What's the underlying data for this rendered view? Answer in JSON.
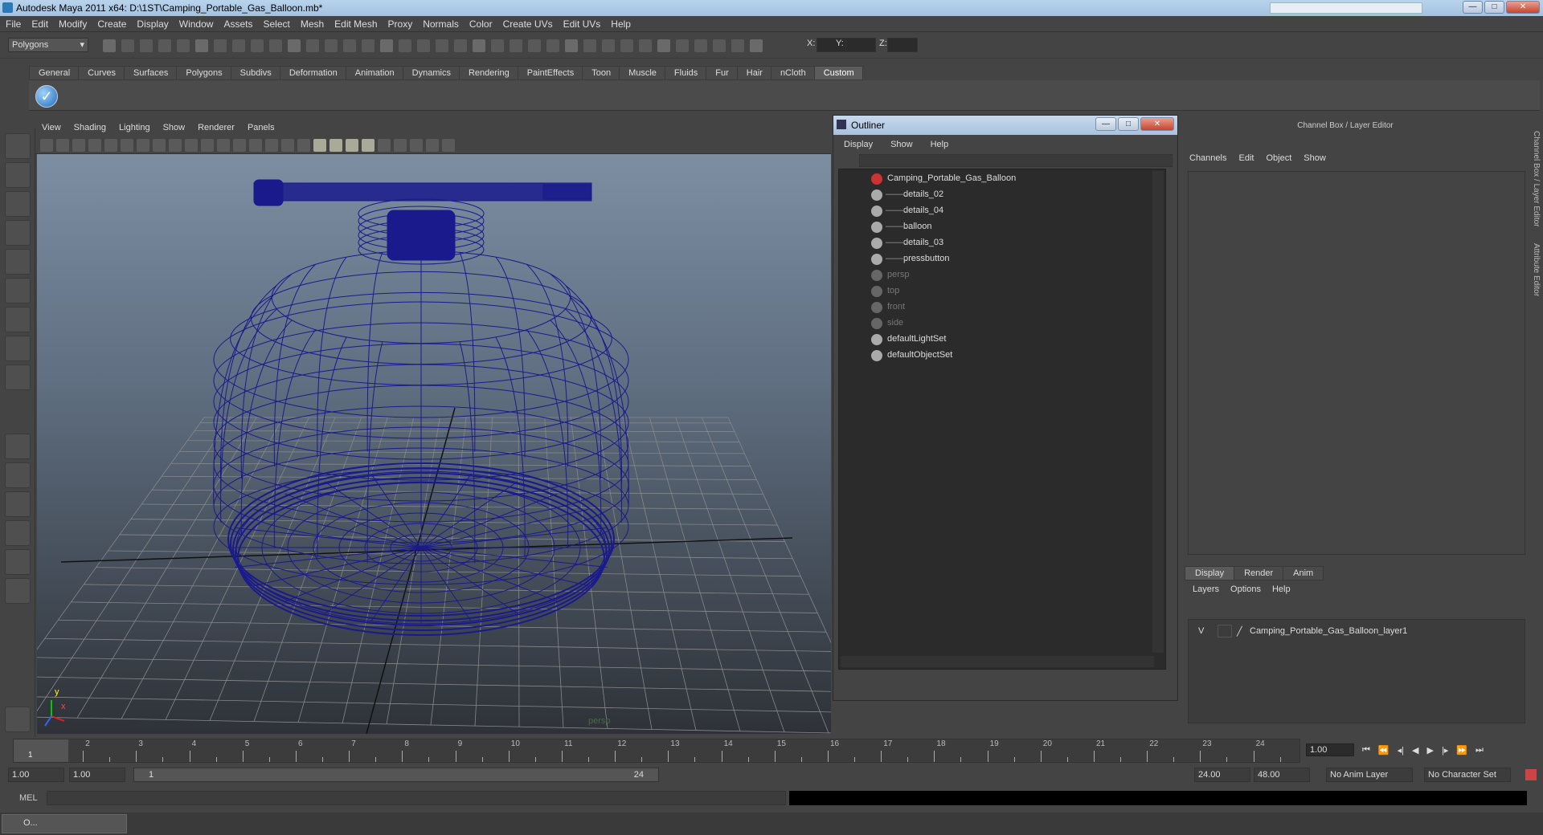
{
  "window": {
    "title": "Autodesk Maya 2011 x64: D:\\1ST\\Camping_Portable_Gas_Balloon.mb*"
  },
  "menubar": [
    "File",
    "Edit",
    "Modify",
    "Create",
    "Display",
    "Window",
    "Assets",
    "Select",
    "Mesh",
    "Edit Mesh",
    "Proxy",
    "Normals",
    "Color",
    "Create UVs",
    "Edit UVs",
    "Help"
  ],
  "statusline": {
    "mode": "Polygons",
    "x_label": "X:",
    "y_label": "Y:",
    "z_label": "Z:"
  },
  "shelf": {
    "tabs": [
      "General",
      "Curves",
      "Surfaces",
      "Polygons",
      "Subdivs",
      "Deformation",
      "Animation",
      "Dynamics",
      "Rendering",
      "PaintEffects",
      "Toon",
      "Muscle",
      "Fluids",
      "Fur",
      "Hair",
      "nCloth",
      "Custom"
    ],
    "active": "Custom"
  },
  "viewport": {
    "menu": [
      "View",
      "Shading",
      "Lighting",
      "Show",
      "Renderer",
      "Panels"
    ],
    "camera_label": "persp",
    "axis_y": "y",
    "axis_x": "x",
    "wire_color": "#1a1a8c"
  },
  "outliner": {
    "title": "Outliner",
    "menu": [
      "Display",
      "Show",
      "Help"
    ],
    "items": [
      {
        "label": "Camping_Portable_Gas_Balloon",
        "indent": 0,
        "dim": false
      },
      {
        "label": "details_02",
        "indent": 1,
        "dim": false
      },
      {
        "label": "details_04",
        "indent": 1,
        "dim": false
      },
      {
        "label": "balloon",
        "indent": 1,
        "dim": false
      },
      {
        "label": "details_03",
        "indent": 1,
        "dim": false
      },
      {
        "label": "pressbutton",
        "indent": 1,
        "dim": false
      },
      {
        "label": "persp",
        "indent": 0,
        "dim": true
      },
      {
        "label": "top",
        "indent": 0,
        "dim": true
      },
      {
        "label": "front",
        "indent": 0,
        "dim": true
      },
      {
        "label": "side",
        "indent": 0,
        "dim": true
      },
      {
        "label": "defaultLightSet",
        "indent": 0,
        "dim": false
      },
      {
        "label": "defaultObjectSet",
        "indent": 0,
        "dim": false
      }
    ]
  },
  "channelbox": {
    "title": "Channel Box / Layer Editor",
    "menu": [
      "Channels",
      "Edit",
      "Object",
      "Show"
    ],
    "layer_tabs": [
      "Display",
      "Render",
      "Anim"
    ],
    "layer_menu": [
      "Layers",
      "Options",
      "Help"
    ],
    "layer": {
      "visible": "V",
      "name": "Camping_Portable_Gas_Balloon_layer1"
    }
  },
  "sidetabs": [
    "Channel Box / Layer Editor",
    "Attribute Editor"
  ],
  "timeline": {
    "ticks": [
      1,
      2,
      3,
      4,
      5,
      6,
      7,
      8,
      9,
      10,
      11,
      12,
      13,
      14,
      15,
      16,
      17,
      18,
      19,
      20,
      21,
      22,
      23,
      24
    ],
    "current_marker": "1",
    "current_time": "1.00"
  },
  "range": {
    "start": "1.00",
    "playback_start": "1.00",
    "range_start_label": "1",
    "range_end_label": "24",
    "playback_end": "24.00",
    "end": "48.00",
    "anim_layer": "No Anim Layer",
    "character_set": "No Character Set"
  },
  "cmdline": {
    "label": "MEL"
  },
  "taskbar": {
    "item": "O..."
  }
}
